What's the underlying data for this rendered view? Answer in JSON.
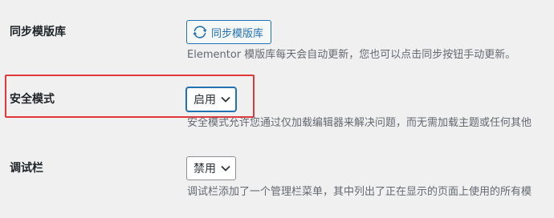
{
  "settings": {
    "sync_library": {
      "label": "同步模版库",
      "button_label": "同步模版库",
      "description": "Elementor 模版库每天会自动更新，您也可以点击同步按钮手动更新。"
    },
    "safe_mode": {
      "label": "安全模式",
      "selected": "启用",
      "description": "安全模式允许您通过仅加载编辑器来解决问题，而无需加载主题或任何其他"
    },
    "debug_bar": {
      "label": "调试栏",
      "selected": "禁用",
      "description": "调试栏添加了一个管理栏菜单，其中列出了正在显示的页面上使用的所有模"
    }
  },
  "colors": {
    "accent": "#2271b1",
    "highlight": "#e0373a",
    "background": "#f0f0f1",
    "description_text": "#646970"
  }
}
